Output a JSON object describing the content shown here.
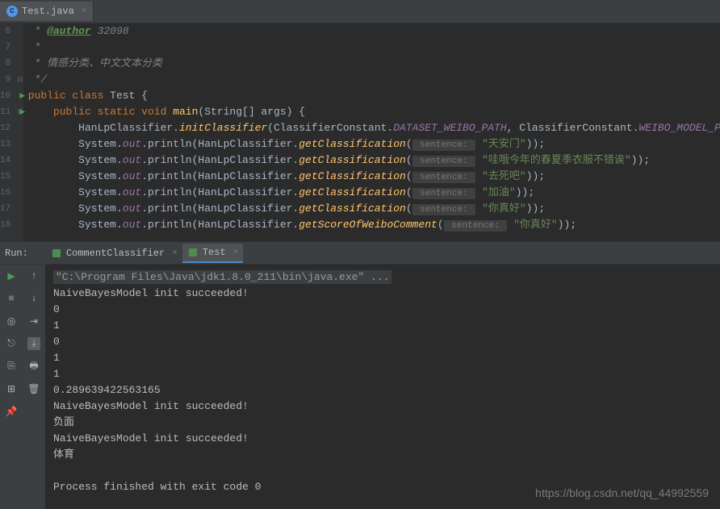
{
  "tab": {
    "filename": "Test.java",
    "icon_letter": "C"
  },
  "code": {
    "lines": [
      {
        "num": 6,
        "parts": [
          {
            "t": " * ",
            "c": "c-comment"
          },
          {
            "t": "@author",
            "c": "c-tag"
          },
          {
            "t": " 32098",
            "c": "c-tag-val"
          }
        ]
      },
      {
        "num": 7,
        "parts": [
          {
            "t": " *",
            "c": "c-comment"
          }
        ]
      },
      {
        "num": 8,
        "parts": [
          {
            "t": " * 情感分类、中文文本分类",
            "c": "c-comment"
          }
        ]
      },
      {
        "num": 9,
        "fold": "⊟",
        "parts": [
          {
            "t": " */",
            "c": "c-comment"
          }
        ]
      },
      {
        "num": 10,
        "arrow": true,
        "parts": [
          {
            "t": "public class ",
            "c": "c-keyword"
          },
          {
            "t": "Test {",
            "c": "c-class"
          }
        ]
      },
      {
        "num": 11,
        "arrow": true,
        "fold": "⊟",
        "parts": [
          {
            "t": "    public static void ",
            "c": "c-keyword"
          },
          {
            "t": "main",
            "c": "c-method"
          },
          {
            "t": "(String[] args) {",
            "c": "c-class"
          }
        ]
      },
      {
        "num": 12,
        "parts": [
          {
            "t": "        HanLpClassifier.",
            "c": "c-class"
          },
          {
            "t": "initClassifier",
            "c": "c-italic-method"
          },
          {
            "t": "(ClassifierConstant.",
            "c": "c-class"
          },
          {
            "t": "DATASET_WEIBO_PATH",
            "c": "c-const"
          },
          {
            "t": ", ClassifierConstant.",
            "c": "c-class"
          },
          {
            "t": "WEIBO_MODEL_PATH",
            "c": "c-const"
          },
          {
            "t": ");",
            "c": "c-class"
          }
        ]
      },
      {
        "num": 13,
        "parts": [
          {
            "t": "        System.",
            "c": "c-class"
          },
          {
            "t": "out",
            "c": "c-field"
          },
          {
            "t": ".println(HanLpClassifier.",
            "c": "c-class"
          },
          {
            "t": "getClassification",
            "c": "c-italic-method"
          },
          {
            "t": "(",
            "c": "c-class"
          },
          {
            "t": " sentence: ",
            "c": "c-param-hint"
          },
          {
            "t": " ",
            "c": ""
          },
          {
            "t": "\"天安门\"",
            "c": "c-string"
          },
          {
            "t": "));",
            "c": "c-class"
          }
        ]
      },
      {
        "num": 14,
        "parts": [
          {
            "t": "        System.",
            "c": "c-class"
          },
          {
            "t": "out",
            "c": "c-field"
          },
          {
            "t": ".println(HanLpClassifier.",
            "c": "c-class"
          },
          {
            "t": "getClassification",
            "c": "c-italic-method"
          },
          {
            "t": "(",
            "c": "c-class"
          },
          {
            "t": " sentence: ",
            "c": "c-param-hint"
          },
          {
            "t": " ",
            "c": ""
          },
          {
            "t": "\"哇哦今年的春夏季衣服不错诶\"",
            "c": "c-string"
          },
          {
            "t": "));",
            "c": "c-class"
          }
        ]
      },
      {
        "num": 15,
        "parts": [
          {
            "t": "        System.",
            "c": "c-class"
          },
          {
            "t": "out",
            "c": "c-field"
          },
          {
            "t": ".println(HanLpClassifier.",
            "c": "c-class"
          },
          {
            "t": "getClassification",
            "c": "c-italic-method"
          },
          {
            "t": "(",
            "c": "c-class"
          },
          {
            "t": " sentence: ",
            "c": "c-param-hint"
          },
          {
            "t": " ",
            "c": ""
          },
          {
            "t": "\"去死吧\"",
            "c": "c-string"
          },
          {
            "t": "));",
            "c": "c-class"
          }
        ]
      },
      {
        "num": 16,
        "parts": [
          {
            "t": "        System.",
            "c": "c-class"
          },
          {
            "t": "out",
            "c": "c-field"
          },
          {
            "t": ".println(HanLpClassifier.",
            "c": "c-class"
          },
          {
            "t": "getClassification",
            "c": "c-italic-method"
          },
          {
            "t": "(",
            "c": "c-class"
          },
          {
            "t": " sentence: ",
            "c": "c-param-hint"
          },
          {
            "t": " ",
            "c": ""
          },
          {
            "t": "\"加油\"",
            "c": "c-string"
          },
          {
            "t": "));",
            "c": "c-class"
          }
        ]
      },
      {
        "num": 17,
        "parts": [
          {
            "t": "        System.",
            "c": "c-class"
          },
          {
            "t": "out",
            "c": "c-field"
          },
          {
            "t": ".println(HanLpClassifier.",
            "c": "c-class"
          },
          {
            "t": "getClassification",
            "c": "c-italic-method"
          },
          {
            "t": "(",
            "c": "c-class"
          },
          {
            "t": " sentence: ",
            "c": "c-param-hint"
          },
          {
            "t": " ",
            "c": ""
          },
          {
            "t": "\"你真好\"",
            "c": "c-string"
          },
          {
            "t": "));",
            "c": "c-class"
          }
        ]
      },
      {
        "num": 18,
        "parts": [
          {
            "t": "        System.",
            "c": "c-class"
          },
          {
            "t": "out",
            "c": "c-field"
          },
          {
            "t": ".println(HanLpClassifier.",
            "c": "c-class"
          },
          {
            "t": "getScoreOfWeiboComment",
            "c": "c-italic-method"
          },
          {
            "t": "(",
            "c": "c-class"
          },
          {
            "t": " sentence: ",
            "c": "c-param-hint"
          },
          {
            "t": " ",
            "c": ""
          },
          {
            "t": "\"你真好\"",
            "c": "c-string"
          },
          {
            "t": "));",
            "c": "c-class"
          }
        ]
      }
    ]
  },
  "run": {
    "label": "Run:",
    "tabs": [
      {
        "name": "CommentClassifier",
        "active": false
      },
      {
        "name": "Test",
        "active": true
      }
    ],
    "console_cmd": "\"C:\\Program Files\\Java\\jdk1.8.0_211\\bin\\java.exe\" ...",
    "output": [
      "NaiveBayesModel init succeeded!",
      "0",
      "1",
      "0",
      "1",
      "1",
      "0.289639422563165",
      "NaiveBayesModel init succeeded!",
      "负面",
      "NaiveBayesModel init succeeded!",
      "体育",
      "",
      "Process finished with exit code 0"
    ]
  },
  "watermark": "https://blog.csdn.net/qq_44992559"
}
